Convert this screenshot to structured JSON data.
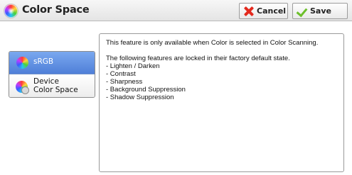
{
  "header": {
    "title": "Color Space",
    "title_icon": "color-wheel-icon",
    "cancel_label": "Cancel",
    "save_label": "Save"
  },
  "options": {
    "items": [
      {
        "label": "sRGB",
        "selected": true,
        "icon": "color-wheel-icon"
      },
      {
        "label_line1": "Device",
        "label_line2": "Color Space",
        "selected": false,
        "icon": "color-wheel-device-icon"
      }
    ]
  },
  "info": {
    "line1": "This feature is only available when Color is selected in Color Scanning.",
    "line2": "The following features are locked in their factory default state.",
    "locked_features": [
      "- Lighten / Darken",
      "- Contrast",
      "- Sharpness",
      "- Background Suppression",
      "- Shadow Suppression"
    ]
  },
  "colors": {
    "selected_bg": "#5a88dd",
    "cancel_icon": "#e32a1e",
    "save_icon": "#6cbf2a"
  }
}
